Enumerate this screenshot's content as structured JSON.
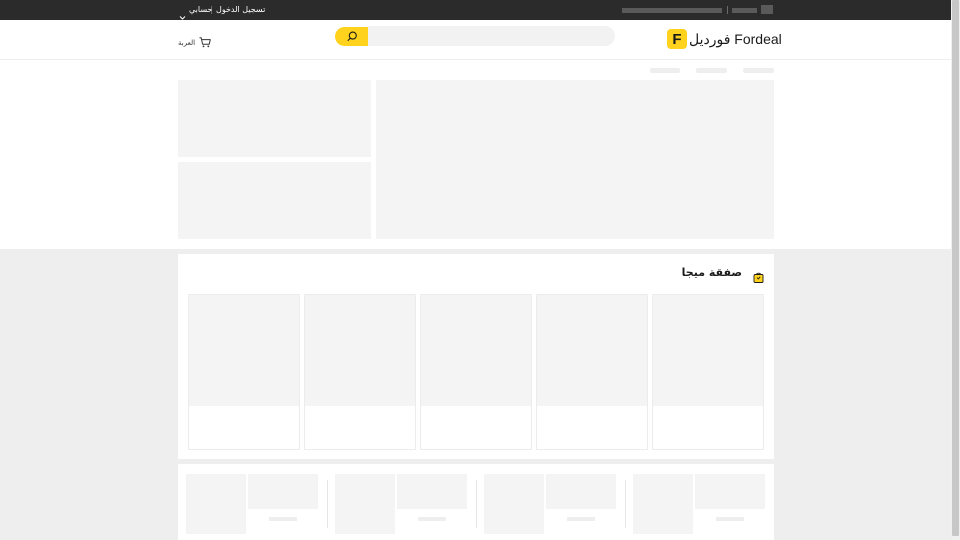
{
  "topbar": {
    "login_label": "تسجيل الدخول",
    "account_label": "حسابي"
  },
  "header": {
    "logo_letter": "F",
    "logo_text": "فوردیل Fordeal",
    "cart_label": "العربة",
    "search_placeholder": ""
  },
  "deal_section": {
    "title": "صفقة ميجا"
  },
  "colors": {
    "accent": "#ffd21e",
    "topbar_bg": "#2b2b2b",
    "placeholder": "#f4f4f4",
    "page_gray": "#eeeeee"
  },
  "icons": [
    "search-icon",
    "cart-icon",
    "chevron-down-icon",
    "shopping-bag-icon"
  ]
}
